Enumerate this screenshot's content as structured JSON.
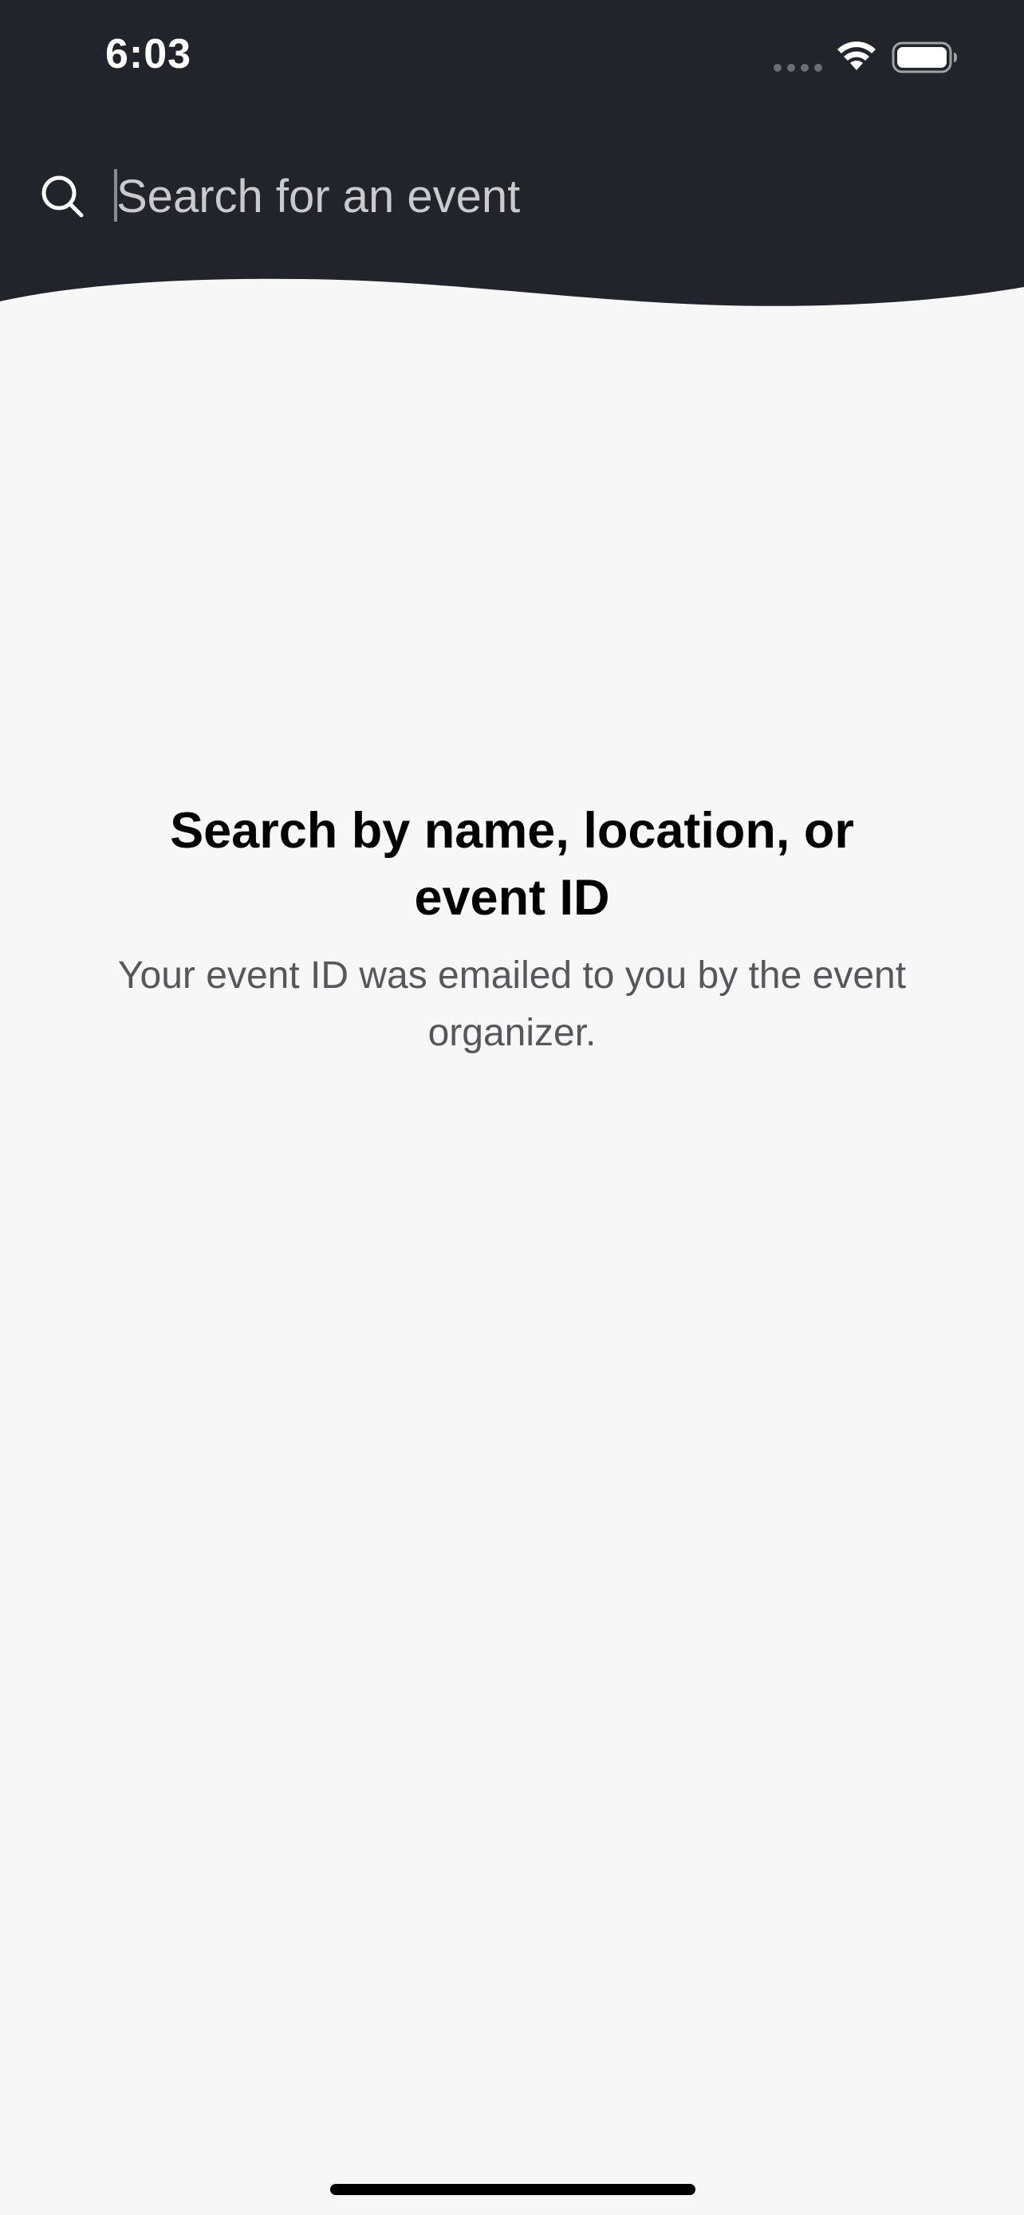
{
  "status_bar": {
    "time": "6:03",
    "signal_icon": "cellular-dots-icon",
    "wifi_icon": "wifi-icon",
    "battery_icon": "battery-icon"
  },
  "search": {
    "icon": "search-icon",
    "placeholder": "Search for an event",
    "value": ""
  },
  "empty_state": {
    "title": "Search by name, location, or event ID",
    "subtitle": "Your event ID was emailed to you by the event organizer."
  },
  "colors": {
    "header_bg": "#21242b",
    "page_bg": "#f7f7f7",
    "title_text": "#000000",
    "subtitle_text": "#55575b"
  }
}
